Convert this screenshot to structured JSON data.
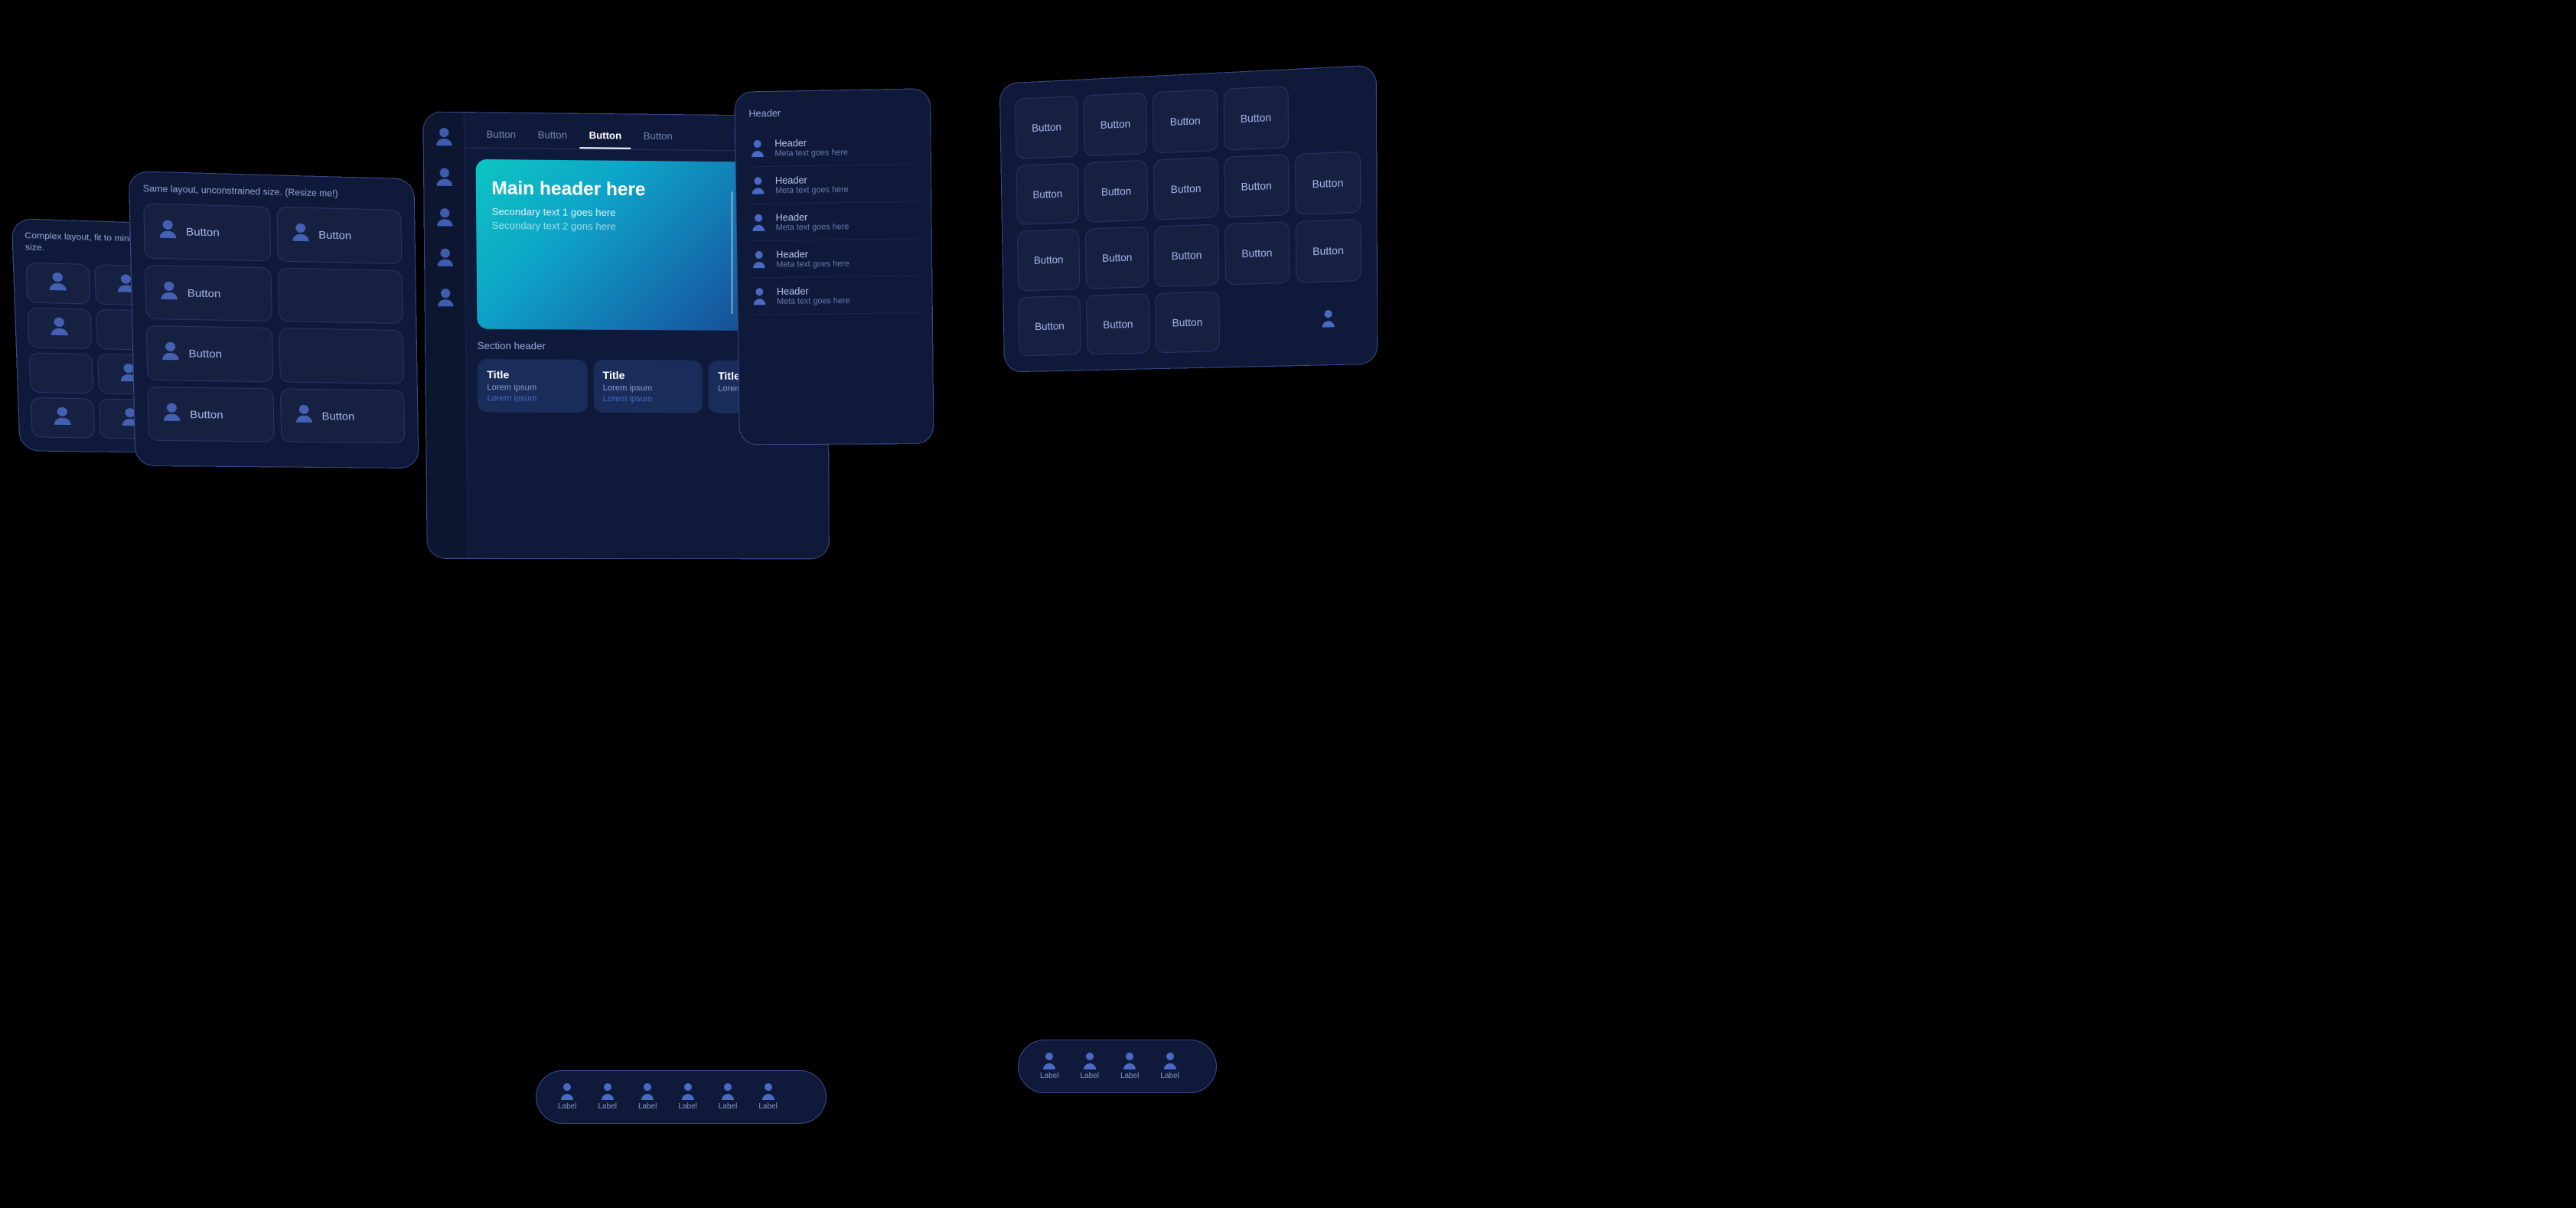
{
  "card1": {
    "label": "Complex layout, fit to minimum size.",
    "cells": [
      {
        "type": "icon"
      },
      {
        "type": "icon"
      },
      {
        "type": "icon"
      },
      {
        "type": "icon"
      },
      {
        "type": "icon"
      },
      {
        "type": "icon"
      },
      {
        "type": "icon"
      },
      {
        "type": "icon"
      }
    ]
  },
  "card2": {
    "label": "Same layout, unconstrained size. (Resize me!)",
    "rows": [
      {
        "right": "Button",
        "left": "Button"
      },
      {
        "right": "Button",
        "left": null
      },
      {
        "right": "Button",
        "left": null
      },
      {
        "right": "Button",
        "left": "Button"
      }
    ]
  },
  "card3": {
    "tabs": [
      "Button",
      "Button",
      "Button",
      "Button"
    ],
    "active_tab": 2,
    "hero": {
      "main_header": "Main header here",
      "secondary_1": "Secondary text 1 goes here",
      "secondary_2": "Secondary text 2 gons here"
    },
    "section_header": "Section header",
    "mini_cards": [
      {
        "title": "Title",
        "lorem1": "Lorem ipsum",
        "lorem2": "Lorem ipsum"
      },
      {
        "title": "Title",
        "lorem1": "Lorem ipsum",
        "lorem2": "Lorem ipsum"
      },
      {
        "title": "Title",
        "lorem1": "Lorem ipsum",
        "lorem2": null
      }
    ]
  },
  "card4": {
    "header": "Header",
    "items": [
      {
        "header": "Header",
        "meta": "Meta text goes here"
      },
      {
        "header": "Header",
        "meta": "Meta text goes here"
      },
      {
        "header": "Header",
        "meta": "Meta text goes here"
      },
      {
        "header": "Header",
        "meta": "Meta text goes here"
      },
      {
        "header": "Header",
        "meta": "Meta text goes here"
      }
    ]
  },
  "card5": {
    "buttons": [
      "Button",
      "Button",
      "Button",
      "Button",
      null,
      "Button",
      "Button",
      "Button",
      "Button",
      "Button",
      "Button",
      "Button",
      "Button",
      "Button",
      "Button",
      "Button",
      "Button",
      "Button",
      null,
      null
    ]
  },
  "nav_bar_1": {
    "items": [
      {
        "label": "Label"
      },
      {
        "label": "Label"
      },
      {
        "label": "Label"
      },
      {
        "label": "Label"
      },
      {
        "label": "Label"
      },
      {
        "label": "Label"
      }
    ]
  },
  "nav_bar_2": {
    "items": [
      {
        "label": "Label"
      },
      {
        "label": "Label"
      },
      {
        "label": "Label"
      },
      {
        "label": "Label"
      }
    ]
  },
  "icons": {
    "person": "👤"
  }
}
